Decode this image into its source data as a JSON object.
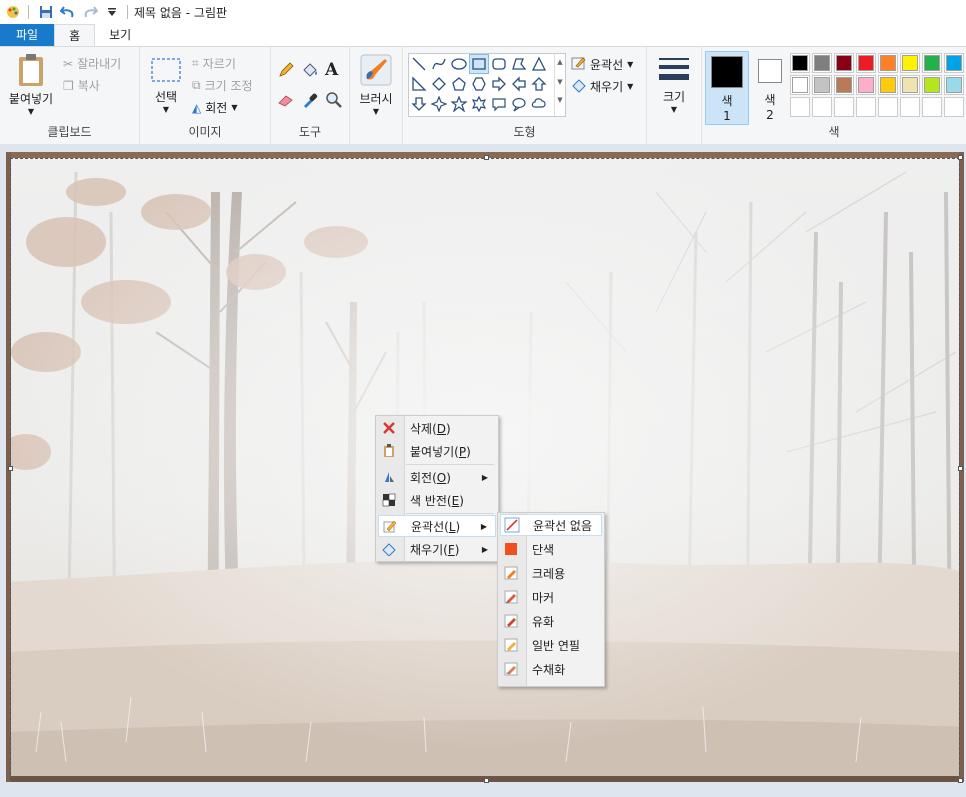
{
  "titlebar": {
    "title": "제목 없음 - 그림판"
  },
  "tabs": [
    {
      "label": "파일"
    },
    {
      "label": "홈"
    },
    {
      "label": "보기"
    }
  ],
  "clipboard": {
    "paste": "붙여넣기",
    "cut": "잘라내기",
    "copy": "복사",
    "label": "클립보드"
  },
  "image": {
    "select": "선택",
    "crop": "자르기",
    "resize": "크기 조정",
    "rotate": "회전",
    "label": "이미지"
  },
  "tools": {
    "label": "도구"
  },
  "brushes": {
    "label": "브러시"
  },
  "shapes": {
    "outline": "윤곽선",
    "fill": "채우기",
    "label": "도형"
  },
  "size": {
    "label": "크기"
  },
  "color1": {
    "line1": "색",
    "line2": "1",
    "value": "#000000"
  },
  "color2": {
    "line1": "색",
    "line2": "2",
    "value": "#ffffff"
  },
  "colors": {
    "label": "색",
    "row1": [
      "#000000",
      "#7f7f7f",
      "#880015",
      "#ed1c24",
      "#ff7f27",
      "#fff200",
      "#22b14c",
      "#00a2e8"
    ],
    "row2": [
      "#ffffff",
      "#c3c3c3",
      "#b97a57",
      "#ffaec9",
      "#ffc90e",
      "#efe4b0",
      "#b5e61d",
      "#99d9ea"
    ]
  },
  "context_menu": {
    "items": [
      {
        "label": "삭제(",
        "key": "D",
        "end": ")"
      },
      {
        "label": "붙여넣기(",
        "key": "P",
        "end": ")"
      },
      {
        "label": "회전(",
        "key": "O",
        "end": ")"
      },
      {
        "label": "색 반전(",
        "key": "E",
        "end": ")"
      },
      {
        "label": "윤곽선(",
        "key": "L",
        "end": ")"
      },
      {
        "label": "채우기(",
        "key": "F",
        "end": ")"
      }
    ]
  },
  "outline_submenu": {
    "items": [
      "윤곽선 없음",
      "단색",
      "크레용",
      "마커",
      "유화",
      "일반 연필",
      "수채화"
    ]
  }
}
